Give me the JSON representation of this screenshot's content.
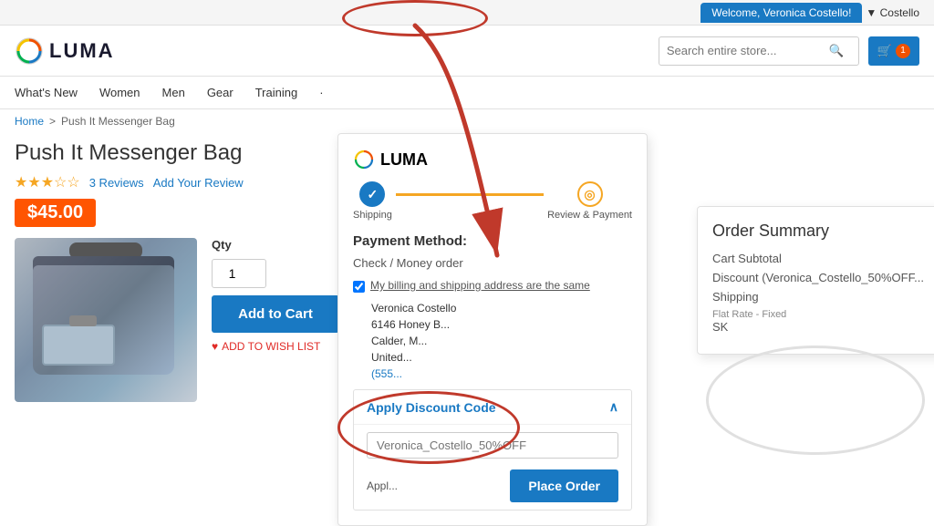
{
  "topbar": {
    "welcome": "Welcome, Veronica Costello!",
    "dropdown_label": "▼ Costello"
  },
  "header": {
    "logo_text": "LUMA",
    "search_placeholder": "Search entire store...",
    "cart_count": "1"
  },
  "nav": {
    "items": [
      {
        "label": "What's New"
      },
      {
        "label": "Women"
      },
      {
        "label": "Men"
      },
      {
        "label": "Gear"
      },
      {
        "label": "Training"
      },
      {
        "label": "·"
      }
    ]
  },
  "breadcrumb": {
    "home": "Home",
    "current": "Push It Messenger Bag"
  },
  "product": {
    "title": "Push It Messenger Bag",
    "rating": "★★★☆☆",
    "reviews_count": "3 Reviews",
    "add_review": "Add Your Review",
    "price": "$45.00",
    "qty_label": "Qty",
    "qty_value": "1",
    "add_to_cart": "Add to Cart",
    "wishlist": "ADD TO WISH LIST"
  },
  "checkout": {
    "logo": "LUMA",
    "step1_label": "Shipping",
    "step2_label": "Review & Payment",
    "payment_method_title": "Payment Method:",
    "payment_option": "Check / Money order",
    "billing_checkbox_label": "My billing and shipping address are the same",
    "address": {
      "name": "Veronica Costello",
      "street": "6146 Honey B...",
      "city": "Calder, M...",
      "country": "United...",
      "phone": "(555..."
    },
    "discount_label": "Apply Discount Code",
    "discount_chevron": "∧",
    "discount_placeholder": "Veronica_Costello_50%OFF",
    "apply_label": "Appl...",
    "place_order": "Place Order"
  },
  "order_summary": {
    "title": "Order Summary",
    "cart_subtotal_label": "Cart Subtotal",
    "discount_label": "Discount (Veronica_Costello_50%OFF...",
    "shipping_label": "Shipping",
    "shipping_detail": "Flat Rate - Fixed",
    "sk_label": "SK"
  }
}
